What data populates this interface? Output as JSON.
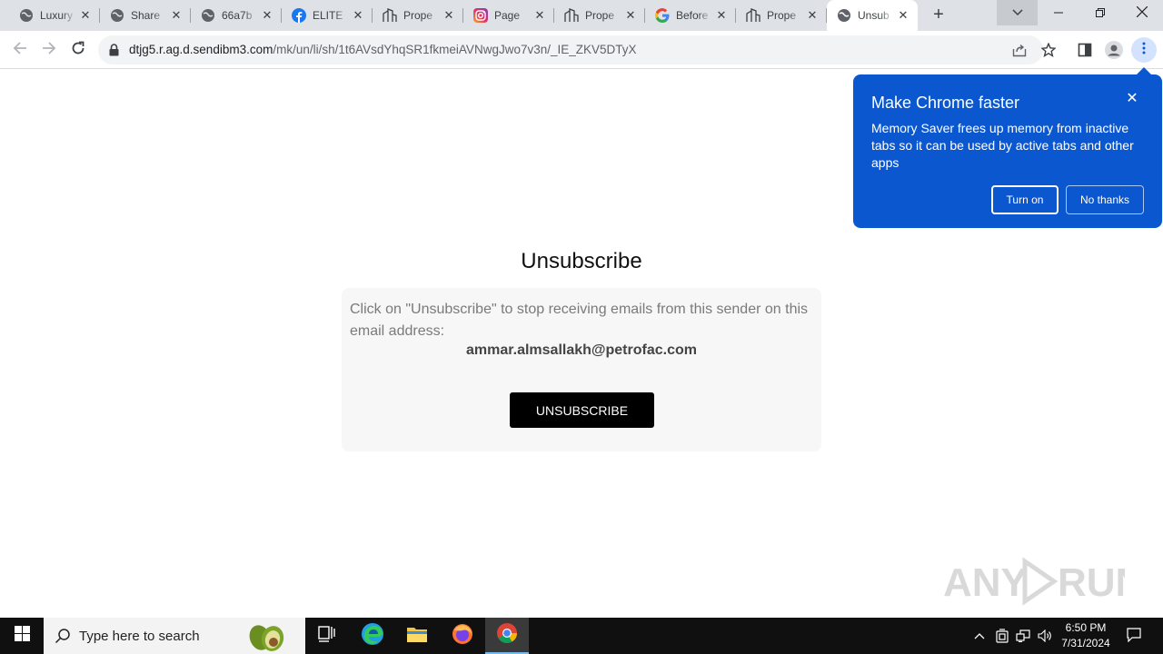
{
  "tabs": [
    {
      "title": "Luxury",
      "icon": "globe-icon"
    },
    {
      "title": "Share",
      "icon": "globe-icon"
    },
    {
      "title": "66a7b",
      "icon": "globe-icon"
    },
    {
      "title": "ELITE",
      "icon": "facebook-icon"
    },
    {
      "title": "Prope",
      "icon": "building-icon"
    },
    {
      "title": "Page",
      "icon": "instagram-icon"
    },
    {
      "title": "Prope",
      "icon": "building-icon"
    },
    {
      "title": "Before",
      "icon": "google-icon"
    },
    {
      "title": "Prope",
      "icon": "building-icon"
    },
    {
      "title": "Unsub",
      "icon": "globe-icon",
      "active": true
    }
  ],
  "address_bar": {
    "host": "dtjg5.r.ag.d.sendibm3.com",
    "path": "/mk/un/li/sh/1t6AVsdYhqSR1fkmeiAVNwgJwo7v3n/_IE_ZKV5DTyX"
  },
  "page": {
    "title": "Unsubscribe",
    "description": "Click on \"Unsubscribe\" to stop receiving emails from this sender on this email address:",
    "email": "ammar.almsallakh@petrofac.com",
    "button_label": "UNSUBSCRIBE"
  },
  "promo": {
    "title": "Make Chrome faster",
    "body": "Memory Saver frees up memory from inactive tabs so it can be used by active tabs and other apps",
    "primary_label": "Turn on",
    "secondary_label": "No thanks"
  },
  "watermark": {
    "text": "ANY RUN"
  },
  "taskbar": {
    "search_placeholder": "Type here to search",
    "time": "6:50 PM",
    "date": "7/31/2024"
  },
  "colors": {
    "promo_bg": "#0b57d0",
    "button_bg": "#000000",
    "card_bg": "#f7f7f7",
    "tabstrip_bg": "#dee1e6"
  }
}
